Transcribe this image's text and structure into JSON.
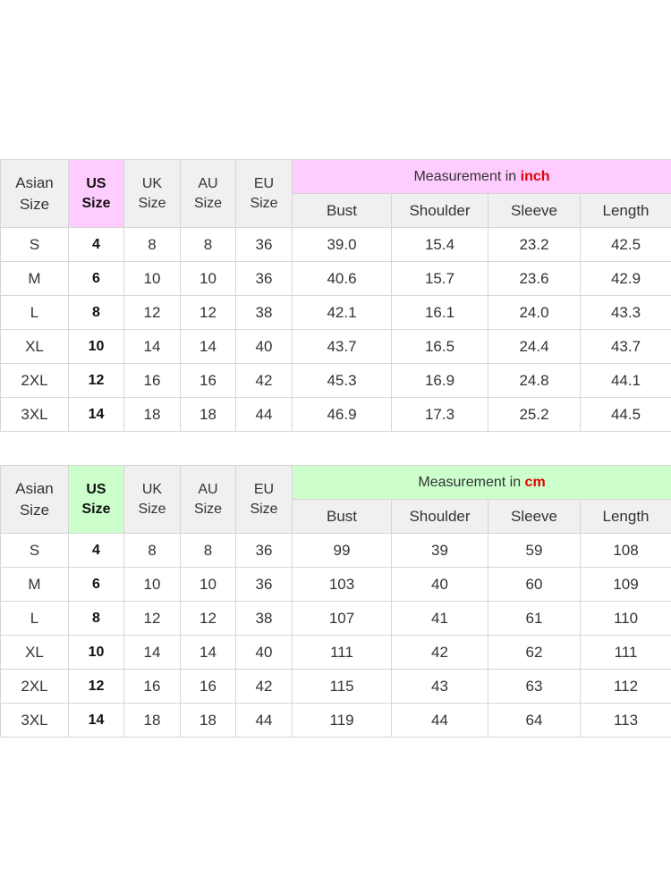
{
  "tables": [
    {
      "accent_color": "#ffccff",
      "headers": {
        "asian": [
          "Asian",
          "Size"
        ],
        "us": [
          "US",
          "Size"
        ],
        "uk": [
          "UK",
          "Size"
        ],
        "au": [
          "AU",
          "Size"
        ],
        "eu": [
          "EU",
          "Size"
        ],
        "measurement_prefix": "Measurement in ",
        "measurement_unit": "inch",
        "columns": [
          "Bust",
          "Shoulder",
          "Sleeve",
          "Length"
        ]
      },
      "rows": [
        [
          "S",
          "4",
          "8",
          "8",
          "36",
          "39.0",
          "15.4",
          "23.2",
          "42.5"
        ],
        [
          "M",
          "6",
          "10",
          "10",
          "36",
          "40.6",
          "15.7",
          "23.6",
          "42.9"
        ],
        [
          "L",
          "8",
          "12",
          "12",
          "38",
          "42.1",
          "16.1",
          "24.0",
          "43.3"
        ],
        [
          "XL",
          "10",
          "14",
          "14",
          "40",
          "43.7",
          "16.5",
          "24.4",
          "43.7"
        ],
        [
          "2XL",
          "12",
          "16",
          "16",
          "42",
          "45.3",
          "16.9",
          "24.8",
          "44.1"
        ],
        [
          "3XL",
          "14",
          "18",
          "18",
          "44",
          "46.9",
          "17.3",
          "25.2",
          "44.5"
        ]
      ]
    },
    {
      "accent_color": "#ccffcc",
      "headers": {
        "asian": [
          "Asian",
          "Size"
        ],
        "us": [
          "US",
          "Size"
        ],
        "uk": [
          "UK",
          "Size"
        ],
        "au": [
          "AU",
          "Size"
        ],
        "eu": [
          "EU",
          "Size"
        ],
        "measurement_prefix": "Measurement in ",
        "measurement_unit": "cm",
        "columns": [
          "Bust",
          "Shoulder",
          "Sleeve",
          "Length"
        ]
      },
      "rows": [
        [
          "S",
          "4",
          "8",
          "8",
          "36",
          "99",
          "39",
          "59",
          "108"
        ],
        [
          "M",
          "6",
          "10",
          "10",
          "36",
          "103",
          "40",
          "60",
          "109"
        ],
        [
          "L",
          "8",
          "12",
          "12",
          "38",
          "107",
          "41",
          "61",
          "110"
        ],
        [
          "XL",
          "10",
          "14",
          "14",
          "40",
          "111",
          "42",
          "62",
          "111"
        ],
        [
          "2XL",
          "12",
          "16",
          "16",
          "42",
          "115",
          "43",
          "63",
          "112"
        ],
        [
          "3XL",
          "14",
          "18",
          "18",
          "44",
          "119",
          "44",
          "64",
          "113"
        ]
      ]
    }
  ]
}
